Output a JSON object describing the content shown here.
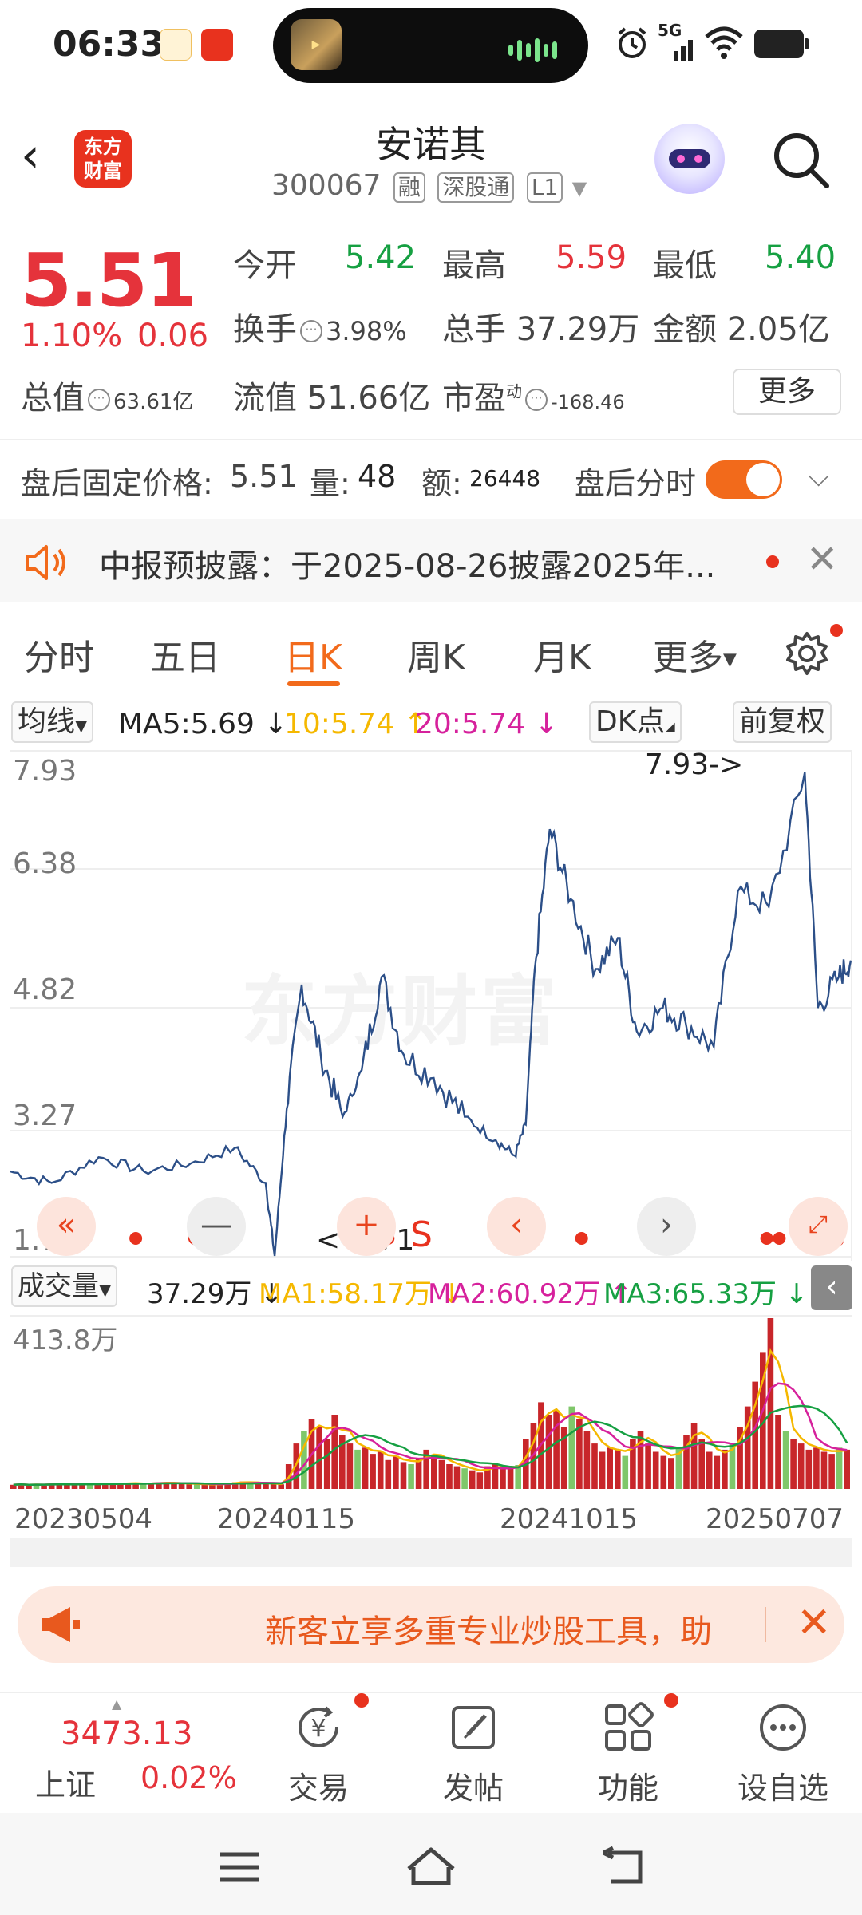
{
  "status_bar": {
    "time": "06:33",
    "network": "5G"
  },
  "header": {
    "stock_name": "安诺其",
    "stock_code": "300067",
    "tags": [
      "融",
      "深股通",
      "L1"
    ],
    "logo_line1": "东方",
    "logo_line2": "财富"
  },
  "quote": {
    "price": "5.51",
    "change_pct": "1.10%",
    "change_amt": "0.06",
    "open_label": "今开",
    "open_value": "5.42",
    "high_label": "最高",
    "high_value": "5.59",
    "low_label": "最低",
    "low_value": "5.40",
    "turnover_label": "换手",
    "turnover_value": "3.98%",
    "volume_label": "总手",
    "volume_value": "37.29万",
    "amount_label": "金额",
    "amount_value": "2.05亿",
    "total_mv_label": "总值",
    "total_mv_value": "63.61亿",
    "float_mv_label": "流值",
    "float_mv_value": "51.66亿",
    "pe_label": "市盈",
    "pe_superscript": "动",
    "pe_value": "-168.46",
    "more_label": "更多"
  },
  "after_hours": {
    "price_label": "盘后固定价格:",
    "price_value": "5.51",
    "vol_label": "量:",
    "vol_value": "48",
    "amt_label": "额:",
    "amt_value": "26448",
    "toggle_label": "盘后分时",
    "toggle_on": true
  },
  "notice": {
    "text": "中报预披露：于2025-08-26披露2025年..."
  },
  "tabs": [
    {
      "label": "分时",
      "active": false
    },
    {
      "label": "五日",
      "active": false
    },
    {
      "label": "日K",
      "active": true
    },
    {
      "label": "周K",
      "active": false
    },
    {
      "label": "月K",
      "active": false
    },
    {
      "label": "更多",
      "active": false
    }
  ],
  "ma_row": {
    "selector": "均线",
    "ma5": "MA5:5.69 ↓",
    "ma10": "10:5.74 ↑",
    "ma20": "20:5.74 ↓",
    "dk_label": "DK点",
    "adjust_label": "前复权",
    "colors": {
      "ma5": "#222222",
      "ma10": "#f5b800",
      "ma20": "#d6219c"
    }
  },
  "chart_data": [
    {
      "type": "line",
      "title": "",
      "y_ticks": [
        "7.93",
        "6.38",
        "4.82",
        "3.27",
        "1.71"
      ],
      "ylim": [
        1.71,
        7.93
      ],
      "max_annotation": "7.93->",
      "min_annotation": "<-1.71",
      "signal_markers": [
        "S",
        "S"
      ],
      "series": [
        {
          "x": [
            "2023-05-04",
            "2023-06-15",
            "2023-08-01",
            "2023-09-15",
            "2023-11-01",
            "2023-12-15",
            "2024-01-15",
            "2024-01-24",
            "2024-02-05",
            "2024-02-20",
            "2024-03-10",
            "2024-04-01",
            "2024-04-20",
            "2024-05-10",
            "2024-06-01",
            "2024-07-01",
            "2024-08-01",
            "2024-09-01",
            "2024-09-20",
            "2024-10-01",
            "2024-10-10",
            "2024-10-25",
            "2024-11-15",
            "2024-12-10",
            "2025-01-01",
            "2025-01-20",
            "2025-02-15",
            "2025-03-10",
            "2025-04-07",
            "2025-05-01",
            "2025-06-01",
            "2025-07-07",
            "2025-07-20",
            "2025-08-10",
            "2025-08-22"
          ],
          "values": [
            2.8,
            2.65,
            2.98,
            2.8,
            2.9,
            3.1,
            2.65,
            1.71,
            3.6,
            5.2,
            4.3,
            3.5,
            4.1,
            5.3,
            4.3,
            4.0,
            3.5,
            3.2,
            3.0,
            3.4,
            5.4,
            7.2,
            6.3,
            5.4,
            5.8,
            4.6,
            4.9,
            4.7,
            4.4,
            6.4,
            6.2,
            7.93,
            4.9,
            5.3,
            5.51
          ]
        }
      ]
    },
    {
      "type": "bar",
      "title": "",
      "y_max_label": "413.8万",
      "x_labels": [
        "20230504",
        "20240115",
        "20241015",
        "20250707"
      ],
      "series": [
        {
          "name": "成交量",
          "values": [
            10,
            12,
            9,
            11,
            10,
            13,
            12,
            11,
            10,
            12,
            14,
            13,
            12,
            11,
            15,
            14,
            13,
            12,
            14,
            16,
            15,
            14,
            13,
            12,
            12,
            11,
            10,
            12,
            14,
            16,
            18,
            15,
            14,
            13,
            12,
            11,
            60,
            110,
            140,
            170,
            150,
            120,
            180,
            130,
            110,
            95,
            100,
            85,
            90,
            70,
            80,
            65,
            60,
            75,
            95,
            80,
            70,
            60,
            55,
            50,
            45,
            40,
            55,
            60,
            48,
            52,
            58,
            120,
            160,
            210,
            180,
            190,
            150,
            200,
            170,
            140,
            110,
            90,
            100,
            95,
            80,
            120,
            140,
            110,
            90,
            80,
            75,
            100,
            130,
            160,
            120,
            90,
            80,
            95,
            110,
            150,
            200,
            260,
            330,
            414,
            180,
            140,
            120,
            110,
            95,
            100,
            90,
            85,
            100,
            95
          ]
        },
        {
          "name": "MA1:58.17万",
          "values": []
        },
        {
          "name": "MA2:60.92万",
          "values": []
        },
        {
          "name": "MA3:65.33万",
          "values": []
        }
      ]
    }
  ],
  "volume_row": {
    "selector": "成交量",
    "vol": "37.29万 ↓",
    "ma1": "MA1:58.17万 ↓",
    "ma2": "MA2:60.92万 ↑",
    "ma3": "MA3:65.33万 ↓",
    "colors": {
      "ma1": "#f5b800",
      "ma2": "#d6219c",
      "ma3": "#16a042"
    }
  },
  "promo": {
    "text": "新客立享多重专业炒股工具，助"
  },
  "bottom_nav": {
    "index_value": "3473.13",
    "index_name": "上证",
    "index_change": "0.02%",
    "items": [
      {
        "label": "交易",
        "icon": "yen-refresh-icon"
      },
      {
        "label": "发帖",
        "icon": "edit-icon"
      },
      {
        "label": "功能",
        "icon": "grid-icon"
      },
      {
        "label": "设自选",
        "icon": "more-dots-icon"
      }
    ]
  }
}
